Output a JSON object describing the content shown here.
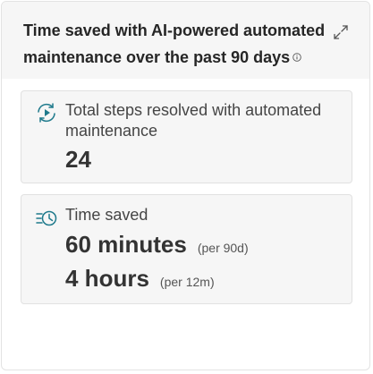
{
  "widget": {
    "title": "Time saved with AI-powered automated maintenance over the past 90 days",
    "info_icon": "info-icon",
    "expand_icon": "expand-icon"
  },
  "steps_card": {
    "icon": "automation-cycle-icon",
    "label": "Total steps resolved with automated maintenance",
    "value": "24"
  },
  "time_card": {
    "icon": "clock-list-icon",
    "label": "Time saved",
    "metrics": [
      {
        "value": "60 minutes",
        "period": "(per 90d)"
      },
      {
        "value": "4 hours",
        "period": "(per 12m)"
      }
    ]
  },
  "colors": {
    "accent": "#1f7a8c",
    "panel_bg": "#f6f6f6",
    "card_border": "#e1e1e1"
  }
}
